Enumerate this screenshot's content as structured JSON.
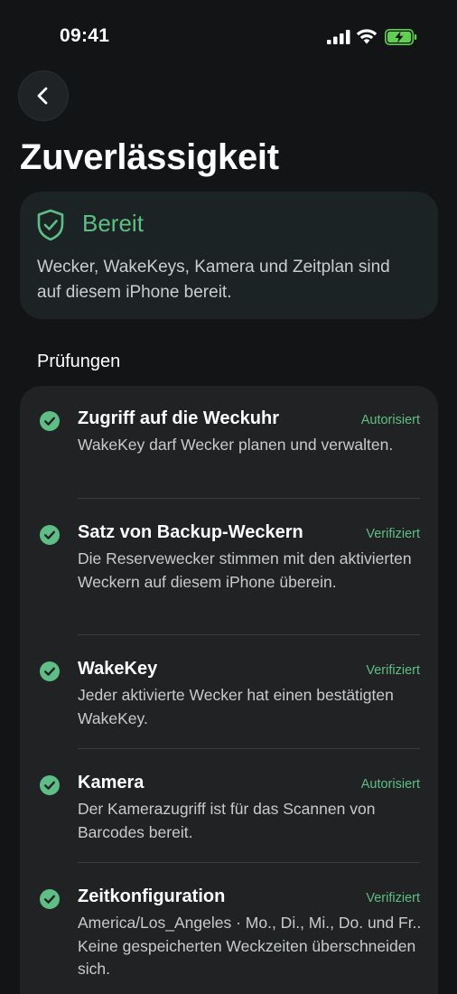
{
  "status_bar": {
    "time": "09:41"
  },
  "page": {
    "title": "Zuverlässigkeit"
  },
  "status_card": {
    "title": "Bereit",
    "description": "Wecker, WakeKeys, Kamera und Zeitplan sind auf diesem iPhone bereit.",
    "accent_color": "#5fbe85"
  },
  "checks": {
    "section_label": "Prüfungen",
    "items": [
      {
        "title": "Zugriff auf die Weckuhr",
        "badge": "Autorisiert",
        "description": "WakeKey darf Wecker planen und verwalten."
      },
      {
        "title": "Satz von Backup-Weckern",
        "badge": "Verifiziert",
        "description": "Die Reservewecker stimmen mit den aktivierten Weckern auf diesem iPhone überein."
      },
      {
        "title": "WakeKey",
        "badge": "Verifiziert",
        "description": "Jeder aktivierte Wecker hat einen bestätigten WakeKey."
      },
      {
        "title": "Kamera",
        "badge": "Autorisiert",
        "description": "Der Kamerazugriff ist für das Scannen von Barcodes bereit."
      },
      {
        "title": "Zeitkonfiguration",
        "badge": "Verifiziert",
        "description": "America/Los_Angeles · Mo., Di., Mi., Do. und Fr.. Keine gespeicherten Weckzeiten überschneiden sich."
      }
    ]
  },
  "icons": {
    "back": "chevron-left-icon",
    "status": "shield-check-icon",
    "check": "check-circle-icon",
    "signal": "cellular-signal-icon",
    "wifi": "wifi-icon",
    "battery": "battery-charging-icon"
  }
}
